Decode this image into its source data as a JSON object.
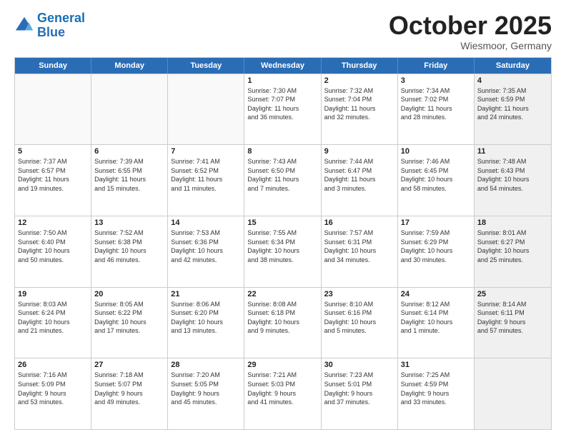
{
  "header": {
    "logo_line1": "General",
    "logo_line2": "Blue",
    "month": "October 2025",
    "location": "Wiesmoor, Germany"
  },
  "day_headers": [
    "Sunday",
    "Monday",
    "Tuesday",
    "Wednesday",
    "Thursday",
    "Friday",
    "Saturday"
  ],
  "weeks": [
    [
      {
        "day": "",
        "info": "",
        "empty": true
      },
      {
        "day": "",
        "info": "",
        "empty": true
      },
      {
        "day": "",
        "info": "",
        "empty": true
      },
      {
        "day": "1",
        "info": "Sunrise: 7:30 AM\nSunset: 7:07 PM\nDaylight: 11 hours\nand 36 minutes."
      },
      {
        "day": "2",
        "info": "Sunrise: 7:32 AM\nSunset: 7:04 PM\nDaylight: 11 hours\nand 32 minutes."
      },
      {
        "day": "3",
        "info": "Sunrise: 7:34 AM\nSunset: 7:02 PM\nDaylight: 11 hours\nand 28 minutes."
      },
      {
        "day": "4",
        "info": "Sunrise: 7:35 AM\nSunset: 6:59 PM\nDaylight: 11 hours\nand 24 minutes.",
        "shaded": true
      }
    ],
    [
      {
        "day": "5",
        "info": "Sunrise: 7:37 AM\nSunset: 6:57 PM\nDaylight: 11 hours\nand 19 minutes."
      },
      {
        "day": "6",
        "info": "Sunrise: 7:39 AM\nSunset: 6:55 PM\nDaylight: 11 hours\nand 15 minutes."
      },
      {
        "day": "7",
        "info": "Sunrise: 7:41 AM\nSunset: 6:52 PM\nDaylight: 11 hours\nand 11 minutes."
      },
      {
        "day": "8",
        "info": "Sunrise: 7:43 AM\nSunset: 6:50 PM\nDaylight: 11 hours\nand 7 minutes."
      },
      {
        "day": "9",
        "info": "Sunrise: 7:44 AM\nSunset: 6:47 PM\nDaylight: 11 hours\nand 3 minutes."
      },
      {
        "day": "10",
        "info": "Sunrise: 7:46 AM\nSunset: 6:45 PM\nDaylight: 10 hours\nand 58 minutes."
      },
      {
        "day": "11",
        "info": "Sunrise: 7:48 AM\nSunset: 6:43 PM\nDaylight: 10 hours\nand 54 minutes.",
        "shaded": true
      }
    ],
    [
      {
        "day": "12",
        "info": "Sunrise: 7:50 AM\nSunset: 6:40 PM\nDaylight: 10 hours\nand 50 minutes."
      },
      {
        "day": "13",
        "info": "Sunrise: 7:52 AM\nSunset: 6:38 PM\nDaylight: 10 hours\nand 46 minutes."
      },
      {
        "day": "14",
        "info": "Sunrise: 7:53 AM\nSunset: 6:36 PM\nDaylight: 10 hours\nand 42 minutes."
      },
      {
        "day": "15",
        "info": "Sunrise: 7:55 AM\nSunset: 6:34 PM\nDaylight: 10 hours\nand 38 minutes."
      },
      {
        "day": "16",
        "info": "Sunrise: 7:57 AM\nSunset: 6:31 PM\nDaylight: 10 hours\nand 34 minutes."
      },
      {
        "day": "17",
        "info": "Sunrise: 7:59 AM\nSunset: 6:29 PM\nDaylight: 10 hours\nand 30 minutes."
      },
      {
        "day": "18",
        "info": "Sunrise: 8:01 AM\nSunset: 6:27 PM\nDaylight: 10 hours\nand 25 minutes.",
        "shaded": true
      }
    ],
    [
      {
        "day": "19",
        "info": "Sunrise: 8:03 AM\nSunset: 6:24 PM\nDaylight: 10 hours\nand 21 minutes."
      },
      {
        "day": "20",
        "info": "Sunrise: 8:05 AM\nSunset: 6:22 PM\nDaylight: 10 hours\nand 17 minutes."
      },
      {
        "day": "21",
        "info": "Sunrise: 8:06 AM\nSunset: 6:20 PM\nDaylight: 10 hours\nand 13 minutes."
      },
      {
        "day": "22",
        "info": "Sunrise: 8:08 AM\nSunset: 6:18 PM\nDaylight: 10 hours\nand 9 minutes."
      },
      {
        "day": "23",
        "info": "Sunrise: 8:10 AM\nSunset: 6:16 PM\nDaylight: 10 hours\nand 5 minutes."
      },
      {
        "day": "24",
        "info": "Sunrise: 8:12 AM\nSunset: 6:14 PM\nDaylight: 10 hours\nand 1 minute."
      },
      {
        "day": "25",
        "info": "Sunrise: 8:14 AM\nSunset: 6:11 PM\nDaylight: 9 hours\nand 57 minutes.",
        "shaded": true
      }
    ],
    [
      {
        "day": "26",
        "info": "Sunrise: 7:16 AM\nSunset: 5:09 PM\nDaylight: 9 hours\nand 53 minutes."
      },
      {
        "day": "27",
        "info": "Sunrise: 7:18 AM\nSunset: 5:07 PM\nDaylight: 9 hours\nand 49 minutes."
      },
      {
        "day": "28",
        "info": "Sunrise: 7:20 AM\nSunset: 5:05 PM\nDaylight: 9 hours\nand 45 minutes."
      },
      {
        "day": "29",
        "info": "Sunrise: 7:21 AM\nSunset: 5:03 PM\nDaylight: 9 hours\nand 41 minutes."
      },
      {
        "day": "30",
        "info": "Sunrise: 7:23 AM\nSunset: 5:01 PM\nDaylight: 9 hours\nand 37 minutes."
      },
      {
        "day": "31",
        "info": "Sunrise: 7:25 AM\nSunset: 4:59 PM\nDaylight: 9 hours\nand 33 minutes."
      },
      {
        "day": "",
        "info": "",
        "empty": true,
        "shaded": true
      }
    ]
  ]
}
